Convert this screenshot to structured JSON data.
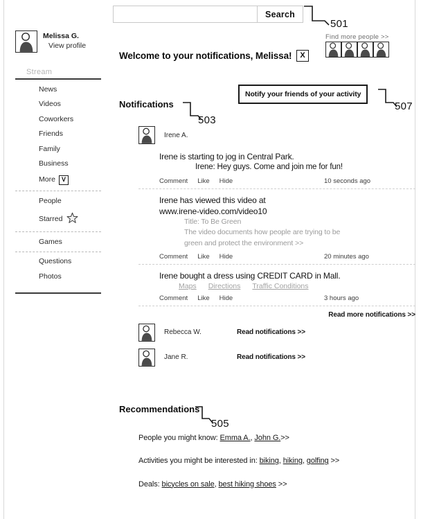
{
  "search": {
    "value": "",
    "placeholder": "",
    "button_label": "Search"
  },
  "ref_numerals": {
    "search": "501",
    "notifications": "503",
    "recommendations": "505",
    "notify_box": "507"
  },
  "header": {
    "find_more_people": "Find more people >>",
    "welcome_title": "Welcome to your notifications, Melissa!",
    "close_label": "X",
    "people_strip": [
      {
        "name": "person-avatar-1"
      },
      {
        "name": "person-avatar-2"
      },
      {
        "name": "person-avatar-3"
      },
      {
        "name": "person-avatar-4"
      }
    ]
  },
  "sidebar": {
    "profile_name": "Melissa G.",
    "profile_link": "View profile",
    "stream_label": "Stream",
    "groups": [
      {
        "items": [
          {
            "label": "News",
            "icon": null
          },
          {
            "label": "Videos",
            "icon": null
          },
          {
            "label": "Coworkers",
            "icon": null
          },
          {
            "label": "Friends",
            "icon": null
          },
          {
            "label": "Family",
            "icon": null
          },
          {
            "label": "Business",
            "icon": null
          },
          {
            "label": "More",
            "icon": "chevron-down-icon",
            "icon_glyph": "V"
          }
        ]
      },
      {
        "items": [
          {
            "label": "People",
            "icon": null
          },
          {
            "label": "Starred",
            "icon": "star-icon"
          }
        ]
      },
      {
        "items": [
          {
            "label": "Games",
            "icon": null
          }
        ]
      },
      {
        "items": [
          {
            "label": "Questions",
            "icon": null
          },
          {
            "label": "Photos",
            "icon": null
          }
        ]
      }
    ]
  },
  "main": {
    "notify_box_label": "Notify your friends of your activity",
    "notifications_heading": "Notifications",
    "recommendations_heading": "Recommendations",
    "read_more_label": "Read more notifications >>",
    "actions": {
      "comment": "Comment",
      "like": "Like",
      "hide": "Hide"
    },
    "feed_person": "Irene A.",
    "notifications": [
      {
        "headline": "Irene is starting to jog in Central Park.",
        "sub": "Irene: Hey guys.  Come and join me for fun!",
        "detail": [],
        "links": [],
        "timestamp": "10 seconds ago"
      },
      {
        "headline": "Irene has viewed this video at",
        "headline2": "www.irene-video.com/video10",
        "sub": "",
        "detail": [
          "Title: To Be Green",
          "The video documents how people are trying to be",
          "green and protect the environment >>"
        ],
        "links": [],
        "timestamp": "20 minutes ago"
      },
      {
        "headline": "Irene bought a dress using CREDIT CARD in Mall.",
        "sub": "",
        "detail": [],
        "links": [
          "Maps",
          "Directions",
          "Traffic Conditions"
        ],
        "timestamp": "3 hours ago"
      }
    ],
    "other_people": [
      {
        "name": "Rebecca W.",
        "link": "Read notifications >>"
      },
      {
        "name": "Jane R.",
        "link": "Read notifications >>"
      }
    ],
    "recommendations": [
      {
        "prefix": "People you might know: ",
        "links": [
          "Emma A.",
          "John G."
        ],
        "separators": [
          ", ",
          " "
        ],
        "suffix": ">>"
      },
      {
        "prefix": "Activities you might be interested in: ",
        "links": [
          "biking",
          "hiking",
          "golfing"
        ],
        "separators": [
          ",  ",
          ", "
        ],
        "suffix": " >>"
      },
      {
        "prefix": "Deals: ",
        "links": [
          "bicycles on sale",
          "best hiking shoes"
        ],
        "separators": [
          ", "
        ],
        "suffix": " >>"
      }
    ]
  }
}
